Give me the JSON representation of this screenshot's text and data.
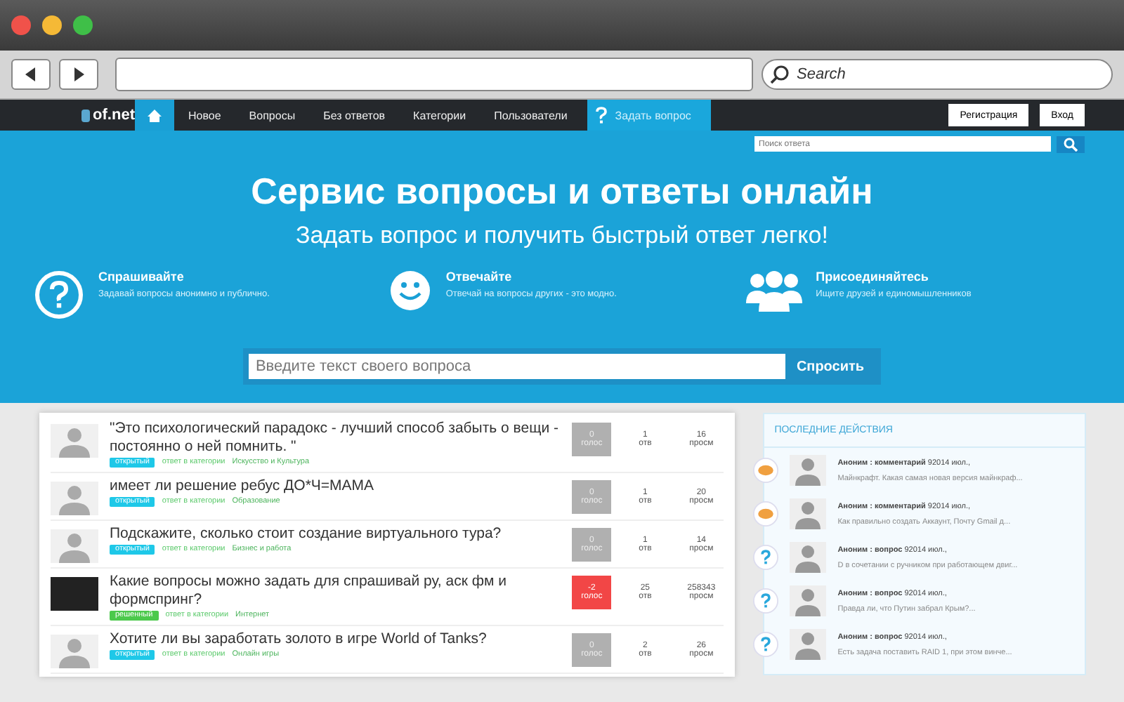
{
  "browser": {
    "search_placeholder": "Search"
  },
  "site": {
    "logo": "of.net",
    "nav": [
      {
        "label": "Новое",
        "selected": false
      },
      {
        "label": "Вопросы",
        "selected": false
      },
      {
        "label": "Без ответов",
        "selected": false
      },
      {
        "label": "Категории",
        "selected": false
      },
      {
        "label": "Пользователи",
        "selected": false
      }
    ],
    "ask_link": "Задать вопрос",
    "auth": [
      "Регистрация",
      "Вход"
    ],
    "search_placeholder": "Поиск ответа"
  },
  "hero": {
    "title": "Сервис вопросы и ответы онлайн",
    "subtitle": "Задать вопрос и получить быстрый ответ легко!",
    "features": [
      {
        "kind": "question",
        "title": "Спрашивайте",
        "text": "Задавай вопросы анонимно и публично."
      },
      {
        "kind": "smile",
        "title": "Отвечайте",
        "text": "Отвечай на вопросы других - это модно."
      },
      {
        "kind": "people",
        "title": "Присоединяйтесь",
        "text": "Ищите друзей и единомышленников"
      }
    ],
    "ask_placeholder": "Введите текст своего вопроса",
    "ask_button": "Спросить"
  },
  "questions": [
    {
      "photo": false,
      "title": "\"Это психологический парадокс - лучший способ забыть о вещи - постоянно о ней помнить. \"",
      "status": "открытый",
      "color": "#1ec8e8",
      "category_prefix": "ответ в категории",
      "category": "Искусство и Культура",
      "votes": "0",
      "votes_label": "голос",
      "negative": false,
      "answers": "1",
      "answers_label": "отв",
      "views": "16",
      "views_label": "просм"
    },
    {
      "photo": false,
      "title": "имеет ли решение ребус ДО*Ч=МАМА",
      "status": "открытый",
      "color": "#1ec8e8",
      "category_prefix": "ответ в категории",
      "category": "Образование",
      "votes": "0",
      "votes_label": "голос",
      "negative": false,
      "answers": "1",
      "answers_label": "отв",
      "views": "20",
      "views_label": "просм"
    },
    {
      "photo": false,
      "title": "Подскажите, сколько стоит создание виртуального тура?",
      "status": "открытый",
      "color": "#1ec8e8",
      "category_prefix": "ответ в категории",
      "category": "Бизнес и работа",
      "votes": "0",
      "votes_label": "голос",
      "negative": false,
      "answers": "1",
      "answers_label": "отв",
      "views": "14",
      "views_label": "просм"
    },
    {
      "photo": true,
      "title": "Какие вопросы можно задать для спрашивай ру, аск фм и формспринг?",
      "status": "решенный",
      "color": "#4cc94c",
      "category_prefix": "ответ в категории",
      "category": "Интернет",
      "votes": "-2",
      "votes_label": "голос",
      "negative": true,
      "answers": "25",
      "answers_label": "отв",
      "views": "258343",
      "views_label": "просм"
    },
    {
      "photo": false,
      "title": "Хотите ли вы заработать золото в игре World of Tanks?",
      "status": "открытый",
      "color": "#1ec8e8",
      "category_prefix": "ответ в категории",
      "category": "Онлайн игры",
      "votes": "0",
      "votes_label": "голос",
      "negative": false,
      "answers": "2",
      "answers_label": "отв",
      "views": "26",
      "views_label": "просм"
    }
  ],
  "activity": {
    "title": "ПОСЛЕДНИЕ ДЕЙСТВИЯ",
    "items": [
      {
        "kind": "comment",
        "heading": "Аноним : комментарий",
        "date": "92014 июл.,",
        "text": "Майнкрафт. Какая самая новая версия майнкраф..."
      },
      {
        "kind": "comment",
        "heading": "Аноним : комментарий",
        "date": "92014 июл.,",
        "text": "Как правильно создать Аккаунт, Почту Gmail д..."
      },
      {
        "kind": "question",
        "heading": "Аноним : вопрос",
        "date": "92014 июл.,",
        "text": "D в сочетании с ручником при работающем двиг..."
      },
      {
        "kind": "question",
        "heading": "Аноним : вопрос",
        "date": "92014 июл.,",
        "text": "Правда ли, что Путин забрал Крым?..."
      },
      {
        "kind": "question",
        "heading": "Аноним : вопрос",
        "date": "92014 июл.,",
        "text": "Есть задача поставить RAID 1, при этом винче..."
      }
    ]
  }
}
